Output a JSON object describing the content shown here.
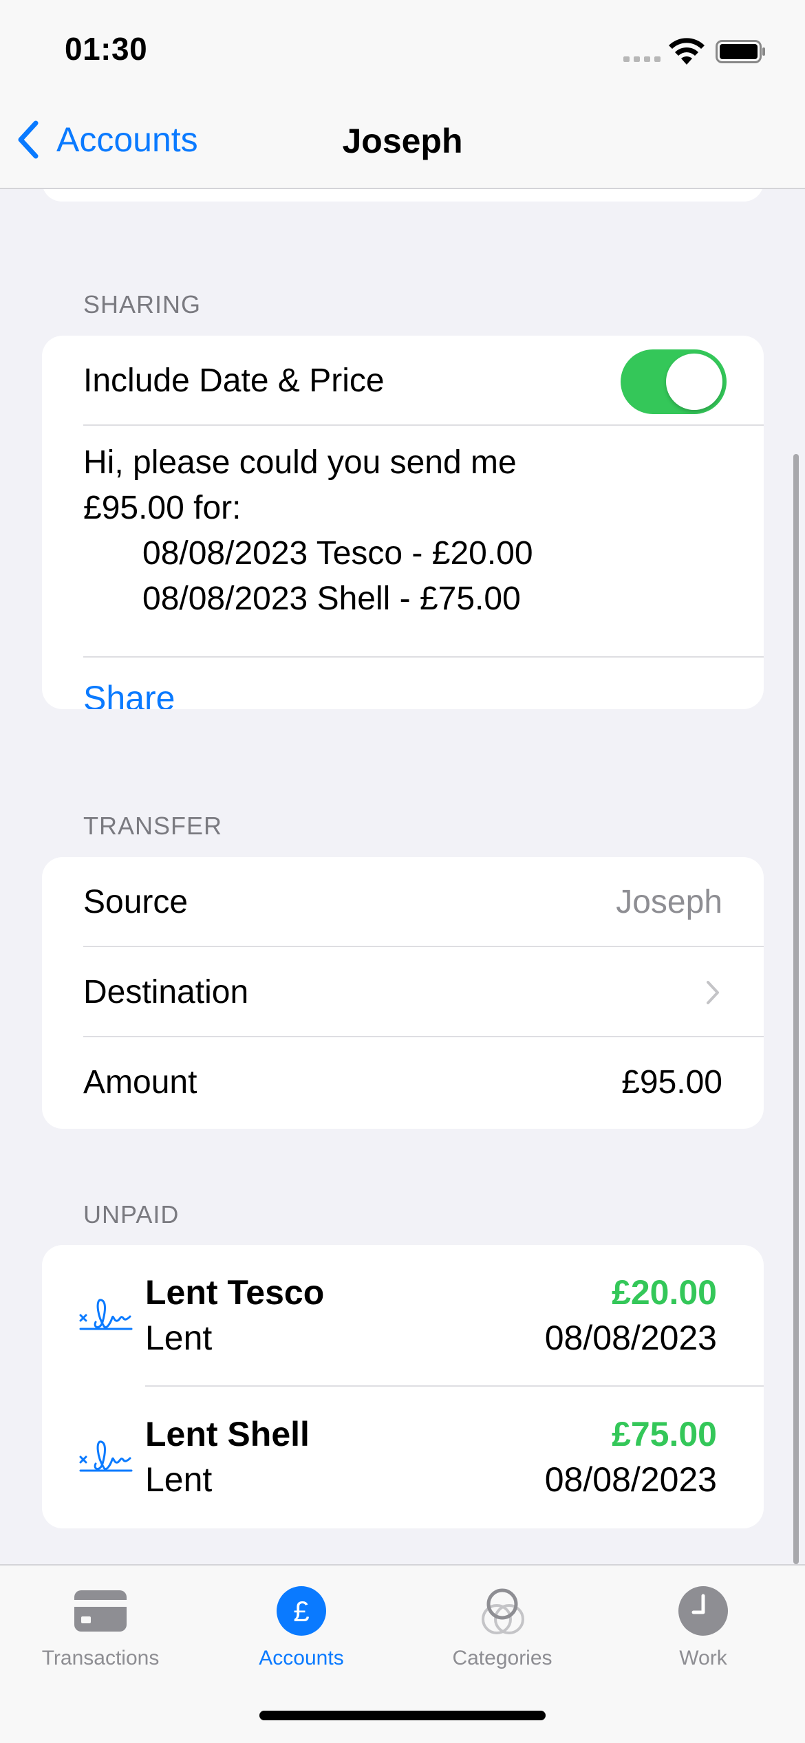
{
  "status_bar": {
    "time": "01:30"
  },
  "nav": {
    "back_label": "Accounts",
    "title": "Joseph"
  },
  "sharing": {
    "header": "SHARING",
    "toggle_label": "Include Date & Price",
    "toggle_on": true,
    "message_lines": [
      "Hi, please could you send me",
      "£95.00 for:",
      "08/08/2023 Tesco - £20.00",
      "08/08/2023 Shell - £75.00"
    ],
    "share_label": "Share"
  },
  "transfer": {
    "header": "TRANSFER",
    "source_label": "Source",
    "source_value": "Joseph",
    "destination_label": "Destination",
    "amount_label": "Amount",
    "amount_value": "£95.00"
  },
  "unpaid": {
    "header": "UNPAID",
    "items": [
      {
        "title": "Lent Tesco",
        "subtitle": "Lent",
        "amount": "£20.00",
        "date": "08/08/2023",
        "icon": "signature-icon"
      },
      {
        "title": "Lent Shell",
        "subtitle": "Lent",
        "amount": "£75.00",
        "date": "08/08/2023",
        "icon": "signature-icon"
      }
    ]
  },
  "tabs": [
    {
      "label": "Transactions",
      "icon": "credit-card-icon",
      "active": false
    },
    {
      "label": "Accounts",
      "icon": "pound-icon",
      "active": true
    },
    {
      "label": "Categories",
      "icon": "categories-icon",
      "active": false
    },
    {
      "label": "Work",
      "icon": "clock-icon",
      "active": false
    }
  ],
  "colors": {
    "accent": "#0a7aff",
    "positive": "#34c759",
    "secondary_text": "#8e8e93",
    "background": "#f2f2f7"
  }
}
